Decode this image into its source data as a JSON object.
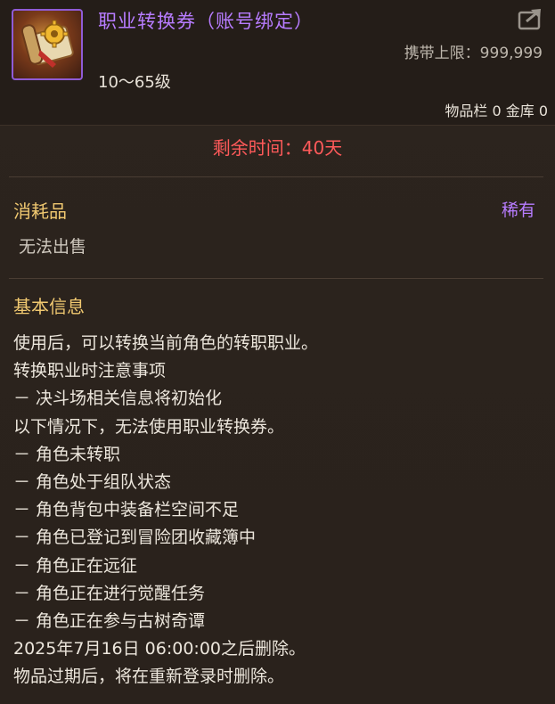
{
  "item": {
    "title": "职业转换券（账号绑定）",
    "carry_limit": "携带上限：999,999",
    "level_range": "10～65级",
    "storage": "物品栏 0 金库 0",
    "remaining_time": "剩余时间：40天",
    "category": "消耗品",
    "rarity": "稀有",
    "trade": "无法出售",
    "section_title": "基本信息",
    "description_lines": [
      "使用后，可以转换当前角色的转职职业。",
      "转换职业时注意事项",
      "－ 决斗场相关信息将初始化",
      "以下情况下，无法使用职业转换券。",
      "－ 角色未转职",
      "－ 角色处于组队状态",
      "－ 角色背包中装备栏空间不足",
      "－ 角色已登记到冒险团收藏簿中",
      "－ 角色正在远征",
      "－ 角色正在进行觉醒任务",
      "－ 角色正在参与古树奇谭",
      "2025年7月16日 06:00:00之后删除。",
      "物品过期后，将在重新登录时删除。"
    ]
  },
  "icons": {
    "item_icon": "scroll-with-gear-icon",
    "export_icon": "share-export-icon"
  },
  "colors": {
    "title": "#b77cff",
    "rarity": "#b77cff",
    "remaining": "#ff5a5a",
    "section_header": "#f0c870",
    "icon_border": "#8f5bd6"
  }
}
